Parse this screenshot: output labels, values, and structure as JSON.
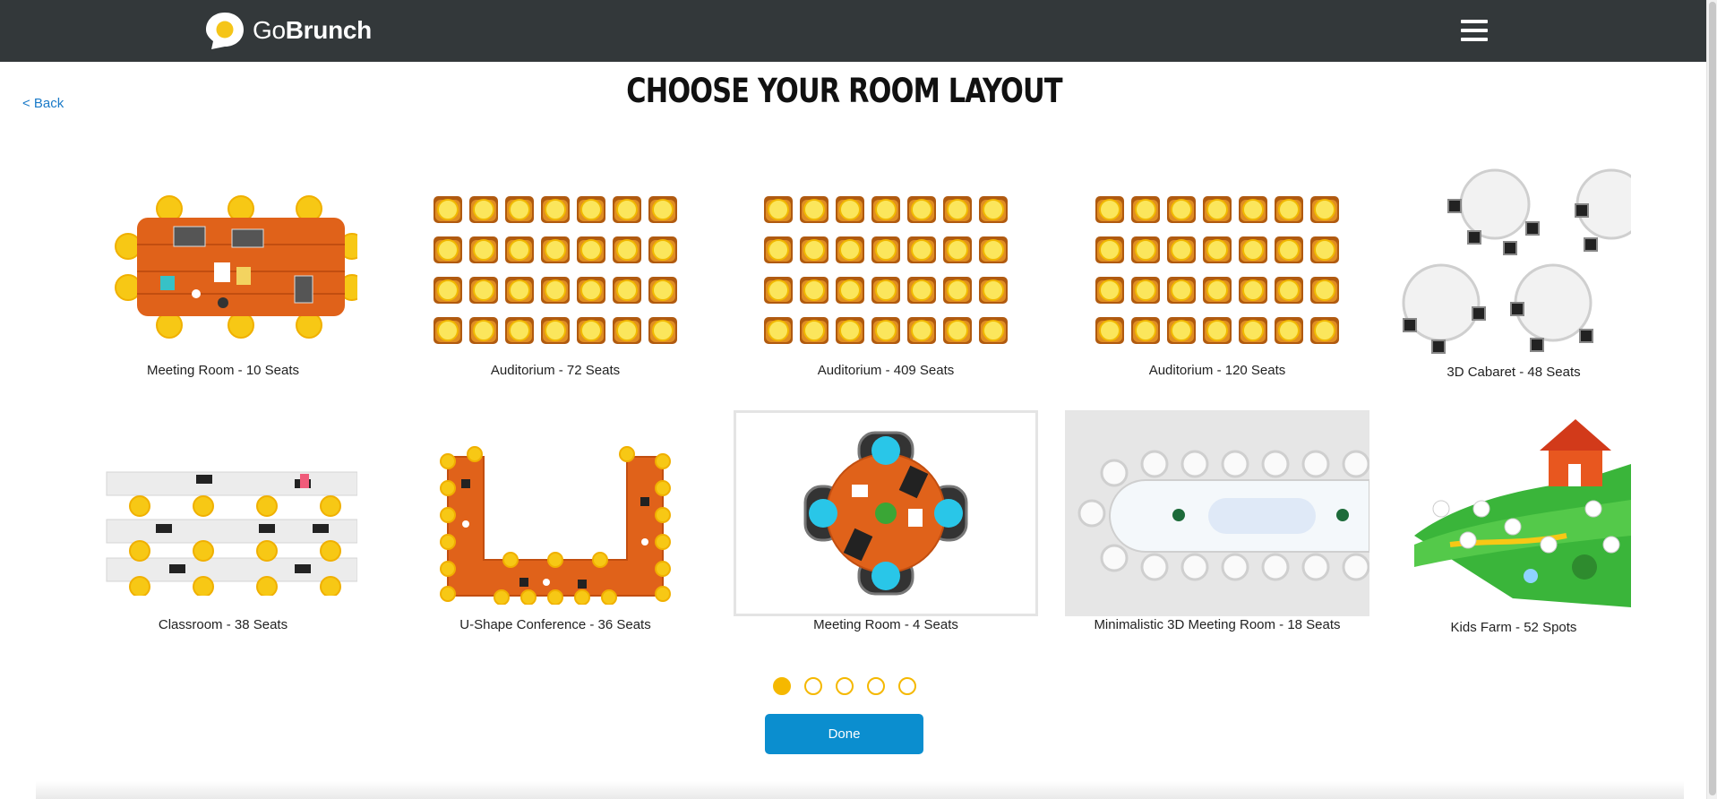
{
  "header": {
    "logo_go": "Go",
    "logo_brunch": "Brunch",
    "logo_icon": "sun-bubble-icon",
    "menu_icon": "hamburger-menu-icon",
    "bar_color": "#33383a"
  },
  "nav": {
    "back_label": "< Back"
  },
  "page": {
    "title": "CHOOSE YOUR ROOM LAYOUT"
  },
  "layouts": [
    {
      "label": "Meeting Room - 10 Seats",
      "icon": "meeting-table-icon"
    },
    {
      "label": "Auditorium - 72 Seats",
      "icon": "auditorium-seats-icon"
    },
    {
      "label": "Auditorium - 409 Seats",
      "icon": "auditorium-seats-icon"
    },
    {
      "label": "Auditorium - 120 Seats",
      "icon": "auditorium-seats-icon"
    },
    {
      "label": "3D Cabaret - 48 Seats",
      "icon": "round-tables-icon"
    },
    {
      "label": "Classroom - 38 Seats",
      "icon": "classroom-desks-icon"
    },
    {
      "label": "U-Shape Conference - 36 Seats",
      "icon": "u-shape-table-icon"
    },
    {
      "label": "Meeting Room - 4 Seats",
      "icon": "round-meeting-table-icon",
      "selected": true
    },
    {
      "label": "Minimalistic 3D Meeting Room - 18 Seats",
      "icon": "long-table-icon"
    },
    {
      "label": "Kids Farm - 52 Spots",
      "icon": "farm-scene-icon"
    }
  ],
  "pagination": {
    "pages": 5,
    "current": 1
  },
  "actions": {
    "done_label": "Done"
  },
  "colors": {
    "accent": "#f5b800",
    "primary_button": "#0b8ecf",
    "link": "#1a7ac8",
    "wood": "#e0621a"
  }
}
